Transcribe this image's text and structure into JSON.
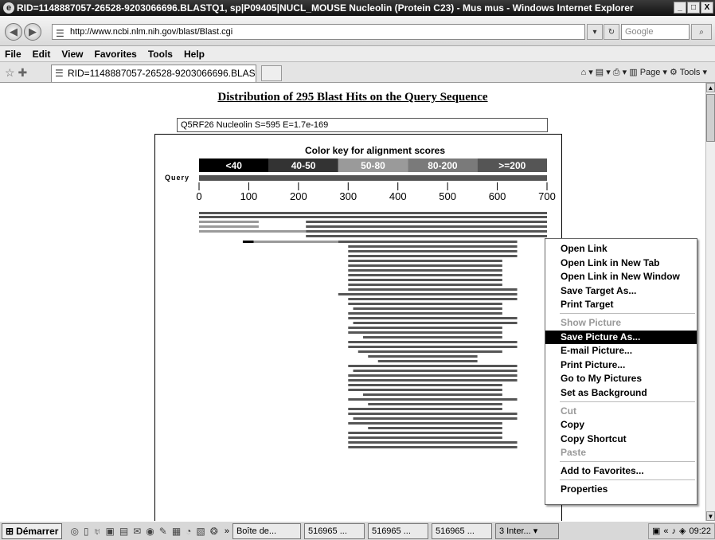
{
  "window": {
    "title": "RID=1148887057-26528-9203066696.BLASTQ1, sp|P09405|NUCL_MOUSE Nucleolin (Protein C23) - Mus mus - Windows Internet Explorer",
    "controls": [
      "_",
      "□",
      "X"
    ]
  },
  "address_bar": {
    "url": "http://www.ncbi.nlm.nih.gov/blast/Blast.cgi",
    "search_placeholder": "Google"
  },
  "menu": [
    "File",
    "Edit",
    "View",
    "Favorites",
    "Tools",
    "Help"
  ],
  "tab": {
    "label": "RID=1148887057-26528-9203066696.BLAS...",
    "commands": "⌂ ▾  ▤ ▾  ⎙ ▾  ▥ Page ▾  ⚙ Tools ▾"
  },
  "page": {
    "heading": "Distribution of 295 Blast Hits on the Query Sequence",
    "hit_info": "Q5RF26 Nucleolin S=595 E=1.7e-169"
  },
  "chart_data": {
    "type": "alignment-map",
    "title": "Color key for alignment scores",
    "color_key": [
      {
        "label": "<40",
        "color": "#000000"
      },
      {
        "label": "40-50",
        "color": "#333333"
      },
      {
        "label": "50-80",
        "color": "#9a9a9a"
      },
      {
        "label": "80-200",
        "color": "#7a7a7a"
      },
      {
        "label": ">=200",
        "color": "#555555"
      }
    ],
    "query_label": "Query",
    "query_length": 700,
    "axis_ticks": [
      0,
      100,
      200,
      300,
      400,
      500,
      600,
      700
    ],
    "hits": [
      [
        0,
        700,
        4
      ],
      [
        0,
        700,
        4
      ],
      [
        0,
        120,
        2
      ],
      [
        215,
        700,
        4
      ],
      [
        0,
        120,
        2
      ],
      [
        215,
        700,
        4
      ],
      [
        0,
        215,
        2
      ],
      [
        215,
        700,
        4
      ],
      [
        215,
        700,
        4
      ],
      [
        88,
        110,
        0
      ],
      [
        110,
        280,
        2
      ],
      [
        280,
        640,
        4
      ],
      [
        300,
        640,
        4
      ],
      [
        300,
        640,
        4
      ],
      [
        300,
        640,
        4
      ],
      [
        300,
        610,
        4
      ],
      [
        300,
        610,
        4
      ],
      [
        300,
        610,
        4
      ],
      [
        300,
        610,
        4
      ],
      [
        300,
        610,
        4
      ],
      [
        300,
        610,
        4
      ],
      [
        300,
        640,
        4
      ],
      [
        280,
        640,
        4
      ],
      [
        300,
        640,
        4
      ],
      [
        300,
        610,
        4
      ],
      [
        310,
        610,
        4
      ],
      [
        300,
        610,
        4
      ],
      [
        300,
        640,
        4
      ],
      [
        310,
        640,
        4
      ],
      [
        300,
        610,
        4
      ],
      [
        300,
        610,
        4
      ],
      [
        330,
        610,
        4
      ],
      [
        300,
        640,
        4
      ],
      [
        300,
        640,
        4
      ],
      [
        320,
        610,
        4
      ],
      [
        340,
        560,
        4
      ],
      [
        360,
        560,
        4
      ],
      [
        300,
        640,
        4
      ],
      [
        310,
        640,
        4
      ],
      [
        300,
        640,
        4
      ],
      [
        300,
        640,
        4
      ],
      [
        300,
        610,
        4
      ],
      [
        300,
        610,
        4
      ],
      [
        330,
        610,
        4
      ],
      [
        300,
        640,
        4
      ],
      [
        340,
        610,
        4
      ],
      [
        300,
        610,
        4
      ],
      [
        300,
        640,
        4
      ],
      [
        310,
        640,
        4
      ],
      [
        300,
        610,
        4
      ],
      [
        340,
        610,
        4
      ],
      [
        300,
        610,
        4
      ],
      [
        300,
        610,
        4
      ],
      [
        300,
        640,
        4
      ],
      [
        300,
        640,
        4
      ]
    ]
  },
  "context_menu": {
    "items": [
      {
        "label": "Open Link",
        "state": "normal"
      },
      {
        "label": "Open Link in New Tab",
        "state": "normal"
      },
      {
        "label": "Open Link in New Window",
        "state": "normal"
      },
      {
        "label": "Save Target As...",
        "state": "normal"
      },
      {
        "label": "Print Target",
        "state": "normal"
      },
      {
        "label": "Show Picture",
        "state": "disabled"
      },
      {
        "label": "Save Picture As...",
        "state": "highlight"
      },
      {
        "label": "E-mail Picture...",
        "state": "normal"
      },
      {
        "label": "Print Picture...",
        "state": "normal"
      },
      {
        "label": "Go to My Pictures",
        "state": "normal"
      },
      {
        "label": "Set as Background",
        "state": "normal"
      },
      {
        "label": "Cut",
        "state": "disabled"
      },
      {
        "label": "Copy",
        "state": "normal"
      },
      {
        "label": "Copy Shortcut",
        "state": "normal"
      },
      {
        "label": "Paste",
        "state": "disabled"
      },
      {
        "label": "Add to Favorites...",
        "state": "normal"
      },
      {
        "label": "Properties",
        "state": "normal"
      }
    ]
  },
  "taskbar": {
    "start_label": "Démarrer",
    "overflow": "»",
    "buttons": [
      "Boîte de...",
      "516965 ...",
      "516965 ...",
      "516965 ...",
      "3 Inter... ▾"
    ],
    "tray_prefix": "«",
    "clock": "09:22"
  }
}
